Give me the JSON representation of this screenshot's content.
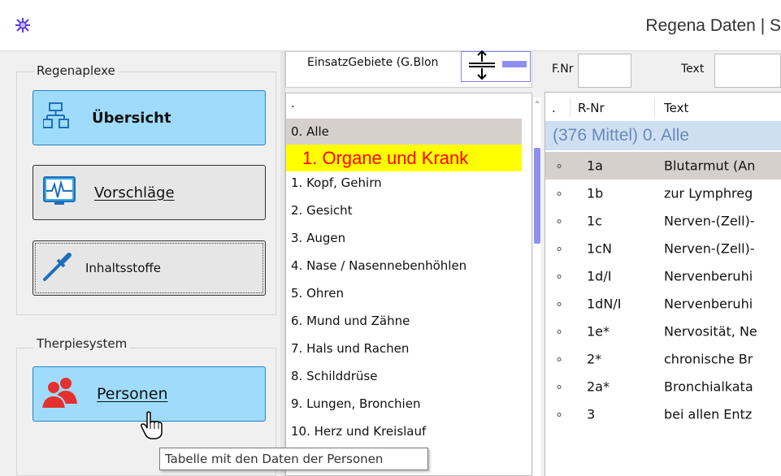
{
  "window": {
    "title": "Regena Daten | S"
  },
  "left": {
    "group1_title": "Regenaplexe",
    "btn_uebersicht": "Übersicht",
    "btn_vorschlaege": "Vorschläge",
    "btn_inhaltsstoffe": "Inhaltsstoffe",
    "group2_title": "Therpiesystem",
    "btn_personen": "Personen"
  },
  "middle": {
    "einsatz_label": "EinsatzGebiete (G.Blon",
    "list": [
      ".",
      "0. Alle",
      "1. Organe und Krank",
      "1. Kopf, Gehirn",
      "2. Gesicht",
      "3. Augen",
      "4. Nase / Nasennebenhöhlen",
      "5. Ohren",
      "6. Mund und Zähne",
      "7. Hals und Rachen",
      "8. Schilddrüse",
      "9. Lungen, Bronchien",
      "10. Herz und Kreislauf"
    ]
  },
  "right": {
    "fnr_label": "F.Nr",
    "text_label": "Text",
    "header": {
      "dot": ".",
      "rnr": "R-Nr",
      "text": "Text"
    },
    "group_row": "(376 Mittel) 0. Alle",
    "rows": [
      {
        "bullet": "∘",
        "rnr": "1a",
        "text": "Blutarmut (An"
      },
      {
        "bullet": "∘",
        "rnr": "1b",
        "text": "zur Lymphreg"
      },
      {
        "bullet": "∘",
        "rnr": "1c",
        "text": "Nerven-(Zell)-"
      },
      {
        "bullet": "∘",
        "rnr": "1cN",
        "text": "Nerven-(Zell)-"
      },
      {
        "bullet": "∘",
        "rnr": "1d/I",
        "text": "Nervenberuhi"
      },
      {
        "bullet": "∘",
        "rnr": "1dN/I",
        "text": "Nervenberuhi"
      },
      {
        "bullet": "∘",
        "rnr": "1e*",
        "text": "Nervosität, Ne"
      },
      {
        "bullet": "∘",
        "rnr": "2*",
        "text": "chronische Br"
      },
      {
        "bullet": "∘",
        "rnr": "2a*",
        "text": "Bronchialkata"
      },
      {
        "bullet": "∘",
        "rnr": "3",
        "text": "bei allen Entz"
      }
    ]
  },
  "tooltip": "Tabelle mit den Daten der Personen",
  "colors": {
    "accent_blue": "#99d9f9",
    "highlight_yellow": "#ffff00",
    "highlight_red_text": "#ff0000",
    "selected_gray": "#d6d0cc",
    "group_row_text": "#6a8ab8",
    "scroll_thumb": "#8f8ff0"
  },
  "icons": {
    "app": "app-icon",
    "uebersicht": "sitemap-icon",
    "vorschlaege": "heartbeat-icon",
    "inhaltsstoffe": "pipette-icon",
    "personen": "people-icon",
    "resize": "resize-cursor-icon",
    "hand": "hand-cursor-icon"
  }
}
